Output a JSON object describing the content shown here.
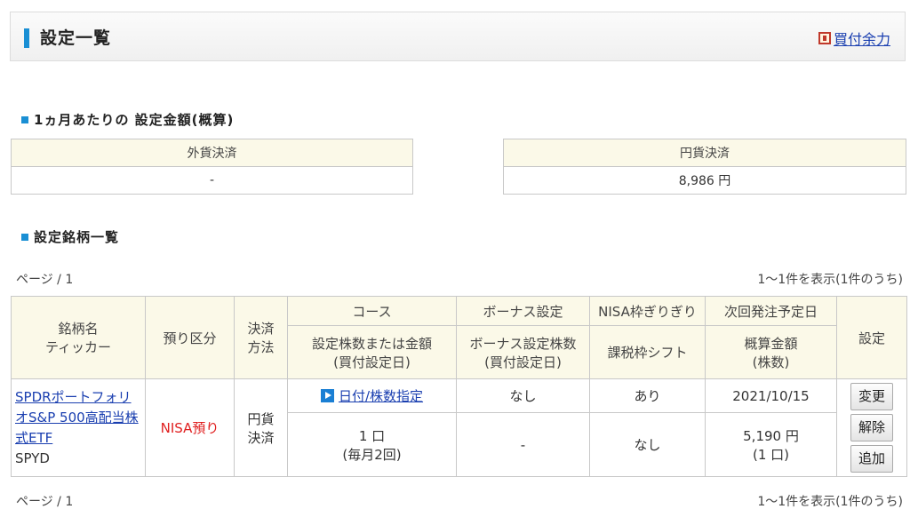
{
  "header": {
    "title": "設定一覧",
    "buying_power_link": "買付余力"
  },
  "monthly": {
    "title": "1ヵ月あたりの 設定金額(概算)",
    "foreign": {
      "label": "外貨決済",
      "value": "-"
    },
    "yen": {
      "label": "円貨決済",
      "value": "8,986 円"
    }
  },
  "list": {
    "title": "設定銘柄一覧",
    "page_label": "ページ / 1",
    "count_label": "1〜1件を表示(1件のうち)",
    "headers": {
      "stock_name": "銘柄名",
      "ticker": "ティッカー",
      "account_type": "預り区分",
      "settlement_1": "決済",
      "settlement_2": "方法",
      "course": "コース",
      "course_sub_1": "設定株数または金額",
      "course_sub_2": "(買付設定日)",
      "bonus": "ボーナス設定",
      "bonus_sub_1": "ボーナス設定株数",
      "bonus_sub_2": "(買付設定日)",
      "nisa": "NISA枠ぎりぎり",
      "nisa_sub": "課税枠シフト",
      "next_order": "次回発注予定日",
      "next_sub_1": "概算金額",
      "next_sub_2": "(株数)",
      "settings": "設定"
    },
    "row": {
      "stock_name": "SPDRポートフォリオS&P 500高配当株式ETF",
      "ticker": "SPYD",
      "account_type": "NISA預り",
      "settlement_1": "円貨",
      "settlement_2": "決済",
      "course": "日付/株数指定",
      "bonus": "なし",
      "nisa": "あり",
      "next_date": "2021/10/15",
      "shares": "1 口",
      "schedule": "(毎月2回)",
      "bonus_shares": "-",
      "tax_shift": "なし",
      "est_amount": "5,190 円",
      "est_shares": "(1 口)",
      "buttons": {
        "change": "変更",
        "cancel": "解除",
        "add": "追加"
      }
    }
  }
}
